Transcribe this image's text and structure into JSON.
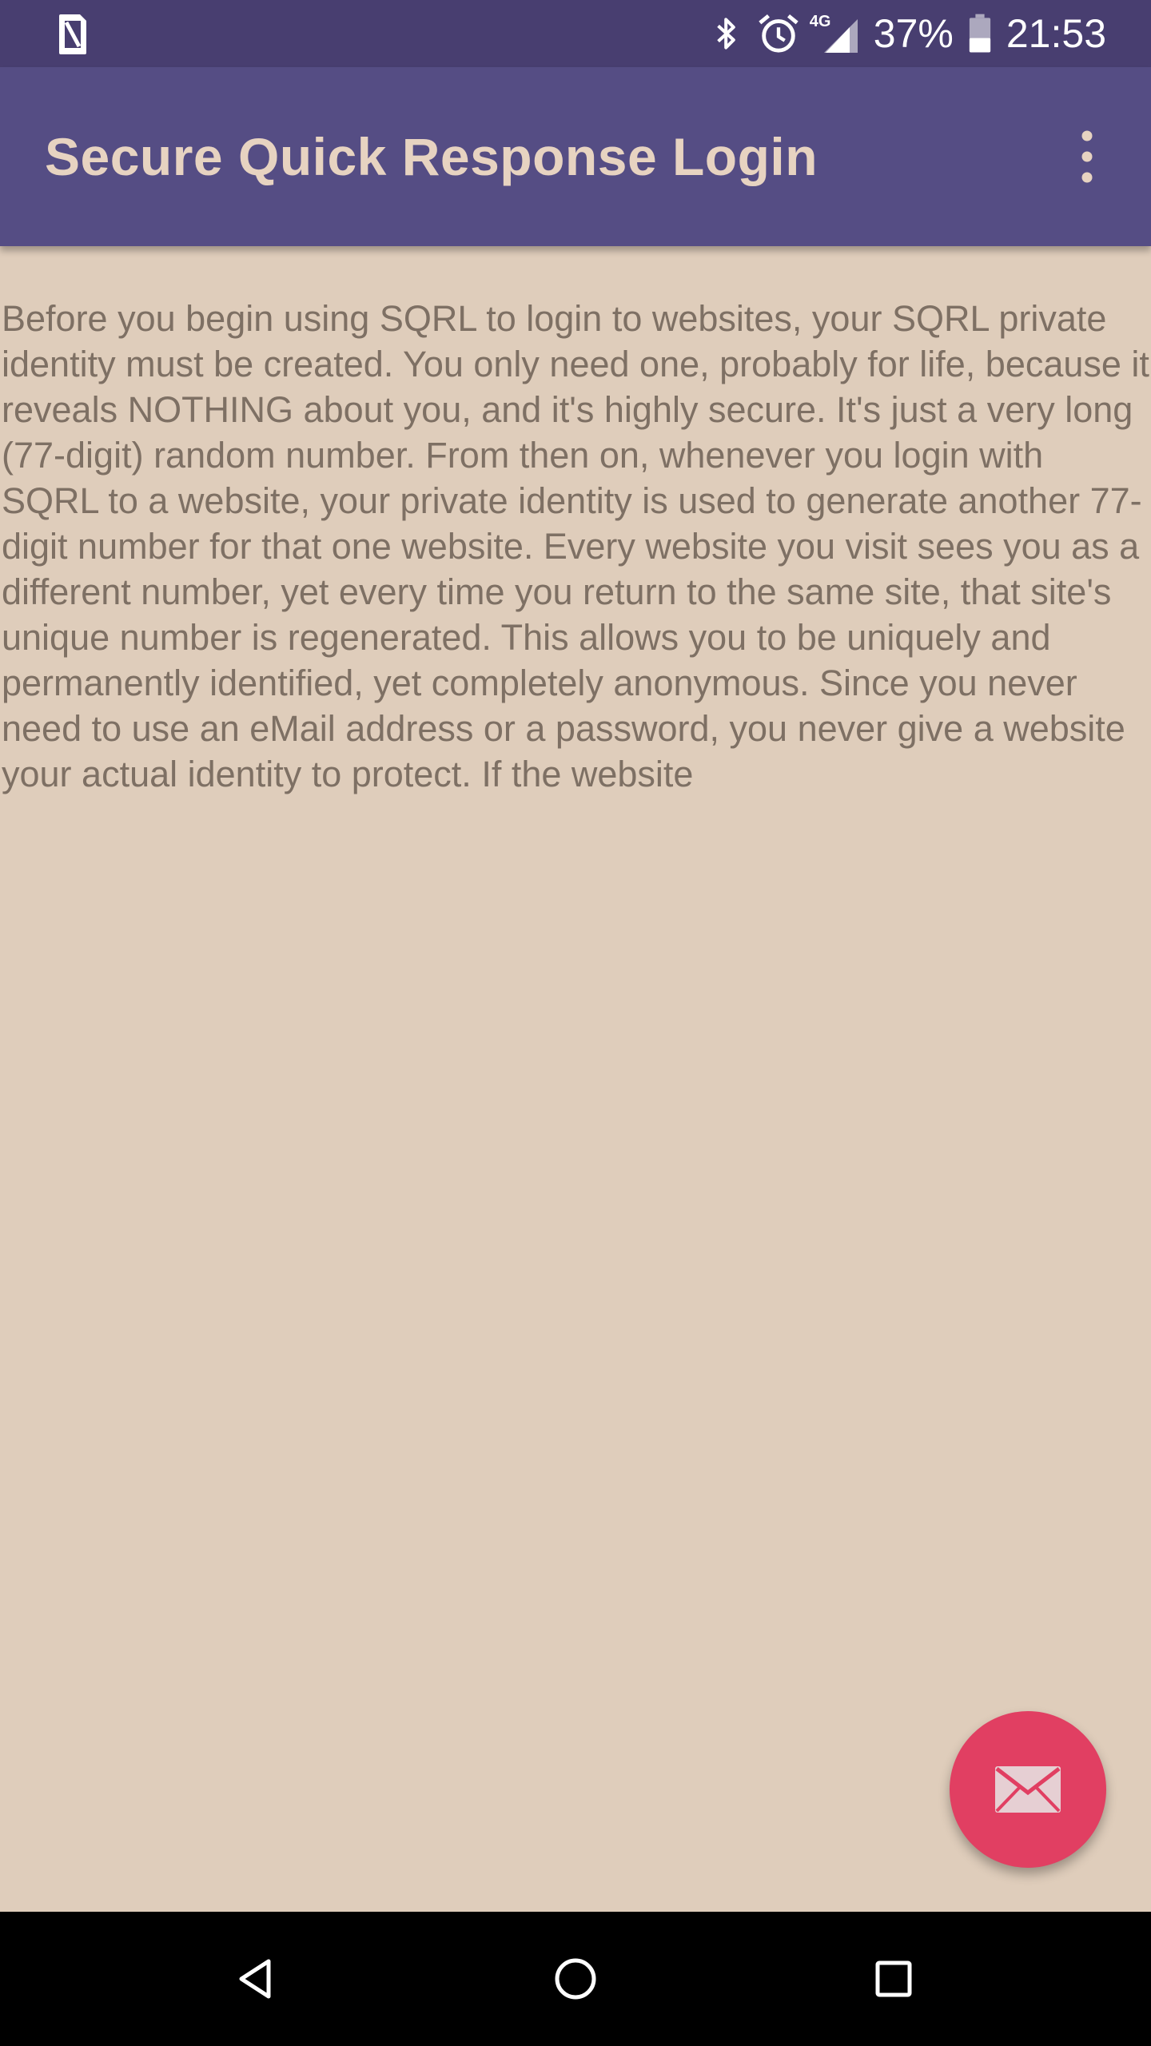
{
  "status_bar": {
    "battery_percent": "37%",
    "time": "21:53",
    "network_label": "4G",
    "icons": [
      "sim-card-icon",
      "bluetooth-icon",
      "alarm-clock-icon",
      "cellular-signal-icon",
      "battery-icon"
    ]
  },
  "app_bar": {
    "title": "Secure Quick Response Login",
    "overflow_icon": "more-vert-icon"
  },
  "content": {
    "intro_text": "Before you begin using SQRL to login to websites, your SQRL private identity must be created. You only need one, probably for life, because it reveals NOTHING about you, and it's highly secure. It's just a very long (77-digit) random number. From then on, whenever you login with SQRL to a website, your private identity is used to generate another 77-digit number for that one website. Every website you visit sees you as a different number, yet every time you return to the same site, that site's unique number is regenerated. This allows you to be uniquely and permanently identified, yet completely anonymous. Since you never need to use an eMail address or a password, you never give a website your actual identity to protect. If the website"
  },
  "fab": {
    "icon": "email-icon"
  },
  "nav_bar": {
    "buttons": [
      "back-icon",
      "home-icon",
      "recents-icon"
    ]
  },
  "colors": {
    "status_bar": "#483e70",
    "app_bar": "#554d84",
    "title_text": "#e7d3c1",
    "background": "#dfcdbb",
    "body_text": "#7e7064",
    "fab": "#e13f62",
    "nav_bar": "#000000"
  }
}
